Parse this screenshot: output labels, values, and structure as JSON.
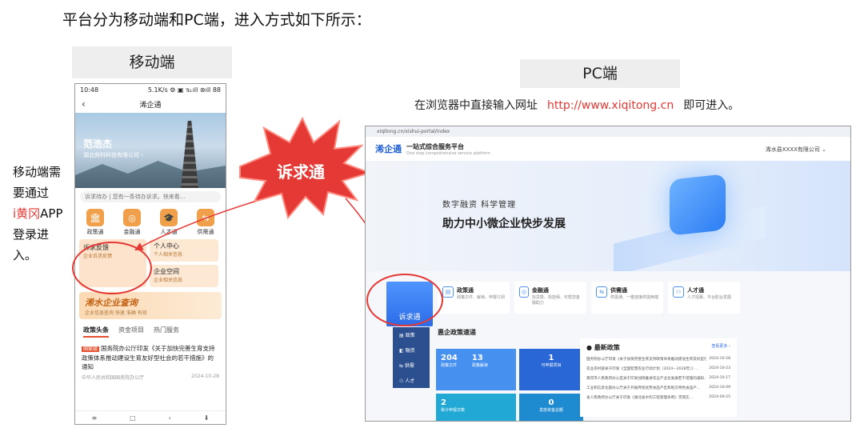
{
  "heading": "平台分为移动端和PC端，进入方式如下所示：",
  "mobile_label": "移动端",
  "pc_label": "PC端",
  "pc_instruction": {
    "prefix": "在浏览器中直接输入网址",
    "url": "http://www.xiqitong.cn",
    "suffix": "即可进入。"
  },
  "side_note": {
    "line1": "移动端需要通过",
    "app": "i黄冈",
    "line2": "APP登录进入。"
  },
  "burst_text": "诉求通",
  "phone": {
    "time": "10:48",
    "status_right": "5.1K/s ⚙ ▣ ℡ıll ⊛ıll 88",
    "title": "浠企通",
    "back": "‹",
    "user_name": "范浩杰",
    "user_company": "湖北奕科科技有限公司 ›",
    "search_placeholder": "诉求待办 | 您有一条待办诉求。快来看...",
    "icons": [
      {
        "label": "政策通",
        "glyph": "🏛"
      },
      {
        "label": "金融通",
        "glyph": "◎"
      },
      {
        "label": "人才通",
        "glyph": "🎓"
      },
      {
        "label": "供需通",
        "glyph": "⇆"
      }
    ],
    "card_big": {
      "title": "诉求反馈",
      "sub": "企业诉求反馈"
    },
    "card_small": [
      {
        "title": "个人中心",
        "sub": "个人相关信息"
      },
      {
        "title": "企业空间",
        "sub": "企业相关信息"
      }
    ],
    "banner": {
      "title": "浠水企业查询",
      "sub": "企业信息查询 快速 准确 有效"
    },
    "tabs": [
      "政策头条",
      "资金项目",
      "热门服务"
    ],
    "news": {
      "tag": "国家级",
      "text": "国务院办公厅印发《关于加快完善生育支持政策体系推动建设生育友好型社会的若干措施》的通知",
      "source": "中华人民共和国国务院办公厅",
      "date": "2024-10-28"
    },
    "bottom_nav": [
      "≡",
      "□",
      "‹",
      "⬇"
    ]
  },
  "pc": {
    "url": "xiqitong.cn/xishui-portal/index",
    "logo": "浠企通",
    "system_title": "一站式综合服务平台",
    "system_title_en": "One stop comprehensive service platform",
    "user": "浠水县XXXX有限公司 ⌄",
    "hero_sub": "数字融资  科学管理",
    "hero_title": "助力中小微企业快步发展",
    "main_category": "诉求通",
    "categories": [
      {
        "name": "政策通",
        "desc": "政策文件、解读、申报订阅",
        "glyph": "▤"
      },
      {
        "name": "金融通",
        "desc": "找贷款、找担保、可帮您金融助力",
        "glyph": "◎"
      },
      {
        "name": "供需通",
        "desc": "供需通、一键连接供需两端",
        "glyph": "⇆"
      },
      {
        "name": "人才通",
        "desc": "人才招募、平台职业发展",
        "glyph": "⚇"
      }
    ],
    "express_title": "惠企政策速递",
    "side_menu": [
      "▤ 政策",
      "◧ 融资",
      "⇆ 供需",
      "⚇ 人才"
    ],
    "stats": [
      {
        "value": "204",
        "label": "政策文件",
        "value2": "13",
        "label2": "政策解读"
      },
      {
        "value": "1",
        "label": "可申报项目"
      },
      {
        "value": "2",
        "label": "累计申报次数"
      },
      {
        "value": "0",
        "label": "发放资金总额"
      }
    ],
    "policy_title": "● 最新政策",
    "policy_more": "查看更多 ›",
    "policies": [
      {
        "text": "国务院办公厅印发《关于加快完善生育支持政策体系推动建设生育友好型社会...",
        "date": "2024-10-28"
      },
      {
        "text": "农业农村部关于印发《全国智慧农业行动计划（2024—2028年）》...",
        "date": "2024-10-23"
      },
      {
        "text": "黄冈市人民政府办公室关于印发加快推进农业产业化发展若干措施的通知...",
        "date": "2024-10-17"
      },
      {
        "text": "工业和信息化部办公厅关于开展传统优势食品产区和地方特色食品产...",
        "date": "2024-10-09"
      },
      {
        "text": "省人民政府办公厅关于印发《湖北省水利工程管理条例》贯彻实...",
        "date": "2024-09-25"
      }
    ]
  },
  "colors": {
    "accent_red": "#e53935",
    "brand_blue": "#2c6ce8",
    "orange": "#f0a04b"
  }
}
